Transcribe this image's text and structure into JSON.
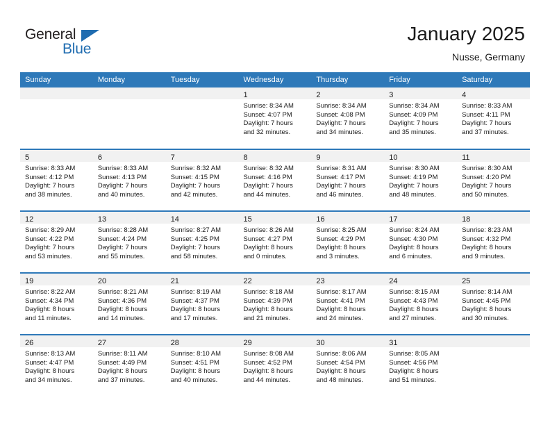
{
  "brand": {
    "name_part1": "General",
    "name_part2": "Blue",
    "triangle_color": "#1f6cb0",
    "text_color": "#231f20"
  },
  "header": {
    "month_title": "January 2025",
    "location": "Nusse, Germany"
  },
  "theme": {
    "header_bg": "#2e79b9",
    "header_text": "#ffffff",
    "daynum_band_bg": "#f1f1f1",
    "cell_bg": "#ffffff",
    "row_divider": "#2e79b9",
    "body_text": "#1a1a1a"
  },
  "weekday_headers": [
    "Sunday",
    "Monday",
    "Tuesday",
    "Wednesday",
    "Thursday",
    "Friday",
    "Saturday"
  ],
  "weeks": [
    [
      {
        "day": "",
        "empty": true,
        "sunrise": "",
        "sunset": "",
        "daylight1": "",
        "daylight2": ""
      },
      {
        "day": "",
        "empty": true,
        "sunrise": "",
        "sunset": "",
        "daylight1": "",
        "daylight2": ""
      },
      {
        "day": "",
        "empty": true,
        "sunrise": "",
        "sunset": "",
        "daylight1": "",
        "daylight2": ""
      },
      {
        "day": "1",
        "empty": false,
        "sunrise": "Sunrise: 8:34 AM",
        "sunset": "Sunset: 4:07 PM",
        "daylight1": "Daylight: 7 hours",
        "daylight2": "and 32 minutes."
      },
      {
        "day": "2",
        "empty": false,
        "sunrise": "Sunrise: 8:34 AM",
        "sunset": "Sunset: 4:08 PM",
        "daylight1": "Daylight: 7 hours",
        "daylight2": "and 34 minutes."
      },
      {
        "day": "3",
        "empty": false,
        "sunrise": "Sunrise: 8:34 AM",
        "sunset": "Sunset: 4:09 PM",
        "daylight1": "Daylight: 7 hours",
        "daylight2": "and 35 minutes."
      },
      {
        "day": "4",
        "empty": false,
        "sunrise": "Sunrise: 8:33 AM",
        "sunset": "Sunset: 4:11 PM",
        "daylight1": "Daylight: 7 hours",
        "daylight2": "and 37 minutes."
      }
    ],
    [
      {
        "day": "5",
        "empty": false,
        "sunrise": "Sunrise: 8:33 AM",
        "sunset": "Sunset: 4:12 PM",
        "daylight1": "Daylight: 7 hours",
        "daylight2": "and 38 minutes."
      },
      {
        "day": "6",
        "empty": false,
        "sunrise": "Sunrise: 8:33 AM",
        "sunset": "Sunset: 4:13 PM",
        "daylight1": "Daylight: 7 hours",
        "daylight2": "and 40 minutes."
      },
      {
        "day": "7",
        "empty": false,
        "sunrise": "Sunrise: 8:32 AM",
        "sunset": "Sunset: 4:15 PM",
        "daylight1": "Daylight: 7 hours",
        "daylight2": "and 42 minutes."
      },
      {
        "day": "8",
        "empty": false,
        "sunrise": "Sunrise: 8:32 AM",
        "sunset": "Sunset: 4:16 PM",
        "daylight1": "Daylight: 7 hours",
        "daylight2": "and 44 minutes."
      },
      {
        "day": "9",
        "empty": false,
        "sunrise": "Sunrise: 8:31 AM",
        "sunset": "Sunset: 4:17 PM",
        "daylight1": "Daylight: 7 hours",
        "daylight2": "and 46 minutes."
      },
      {
        "day": "10",
        "empty": false,
        "sunrise": "Sunrise: 8:30 AM",
        "sunset": "Sunset: 4:19 PM",
        "daylight1": "Daylight: 7 hours",
        "daylight2": "and 48 minutes."
      },
      {
        "day": "11",
        "empty": false,
        "sunrise": "Sunrise: 8:30 AM",
        "sunset": "Sunset: 4:20 PM",
        "daylight1": "Daylight: 7 hours",
        "daylight2": "and 50 minutes."
      }
    ],
    [
      {
        "day": "12",
        "empty": false,
        "sunrise": "Sunrise: 8:29 AM",
        "sunset": "Sunset: 4:22 PM",
        "daylight1": "Daylight: 7 hours",
        "daylight2": "and 53 minutes."
      },
      {
        "day": "13",
        "empty": false,
        "sunrise": "Sunrise: 8:28 AM",
        "sunset": "Sunset: 4:24 PM",
        "daylight1": "Daylight: 7 hours",
        "daylight2": "and 55 minutes."
      },
      {
        "day": "14",
        "empty": false,
        "sunrise": "Sunrise: 8:27 AM",
        "sunset": "Sunset: 4:25 PM",
        "daylight1": "Daylight: 7 hours",
        "daylight2": "and 58 minutes."
      },
      {
        "day": "15",
        "empty": false,
        "sunrise": "Sunrise: 8:26 AM",
        "sunset": "Sunset: 4:27 PM",
        "daylight1": "Daylight: 8 hours",
        "daylight2": "and 0 minutes."
      },
      {
        "day": "16",
        "empty": false,
        "sunrise": "Sunrise: 8:25 AM",
        "sunset": "Sunset: 4:29 PM",
        "daylight1": "Daylight: 8 hours",
        "daylight2": "and 3 minutes."
      },
      {
        "day": "17",
        "empty": false,
        "sunrise": "Sunrise: 8:24 AM",
        "sunset": "Sunset: 4:30 PM",
        "daylight1": "Daylight: 8 hours",
        "daylight2": "and 6 minutes."
      },
      {
        "day": "18",
        "empty": false,
        "sunrise": "Sunrise: 8:23 AM",
        "sunset": "Sunset: 4:32 PM",
        "daylight1": "Daylight: 8 hours",
        "daylight2": "and 9 minutes."
      }
    ],
    [
      {
        "day": "19",
        "empty": false,
        "sunrise": "Sunrise: 8:22 AM",
        "sunset": "Sunset: 4:34 PM",
        "daylight1": "Daylight: 8 hours",
        "daylight2": "and 11 minutes."
      },
      {
        "day": "20",
        "empty": false,
        "sunrise": "Sunrise: 8:21 AM",
        "sunset": "Sunset: 4:36 PM",
        "daylight1": "Daylight: 8 hours",
        "daylight2": "and 14 minutes."
      },
      {
        "day": "21",
        "empty": false,
        "sunrise": "Sunrise: 8:19 AM",
        "sunset": "Sunset: 4:37 PM",
        "daylight1": "Daylight: 8 hours",
        "daylight2": "and 17 minutes."
      },
      {
        "day": "22",
        "empty": false,
        "sunrise": "Sunrise: 8:18 AM",
        "sunset": "Sunset: 4:39 PM",
        "daylight1": "Daylight: 8 hours",
        "daylight2": "and 21 minutes."
      },
      {
        "day": "23",
        "empty": false,
        "sunrise": "Sunrise: 8:17 AM",
        "sunset": "Sunset: 4:41 PM",
        "daylight1": "Daylight: 8 hours",
        "daylight2": "and 24 minutes."
      },
      {
        "day": "24",
        "empty": false,
        "sunrise": "Sunrise: 8:15 AM",
        "sunset": "Sunset: 4:43 PM",
        "daylight1": "Daylight: 8 hours",
        "daylight2": "and 27 minutes."
      },
      {
        "day": "25",
        "empty": false,
        "sunrise": "Sunrise: 8:14 AM",
        "sunset": "Sunset: 4:45 PM",
        "daylight1": "Daylight: 8 hours",
        "daylight2": "and 30 minutes."
      }
    ],
    [
      {
        "day": "26",
        "empty": false,
        "sunrise": "Sunrise: 8:13 AM",
        "sunset": "Sunset: 4:47 PM",
        "daylight1": "Daylight: 8 hours",
        "daylight2": "and 34 minutes."
      },
      {
        "day": "27",
        "empty": false,
        "sunrise": "Sunrise: 8:11 AM",
        "sunset": "Sunset: 4:49 PM",
        "daylight1": "Daylight: 8 hours",
        "daylight2": "and 37 minutes."
      },
      {
        "day": "28",
        "empty": false,
        "sunrise": "Sunrise: 8:10 AM",
        "sunset": "Sunset: 4:51 PM",
        "daylight1": "Daylight: 8 hours",
        "daylight2": "and 40 minutes."
      },
      {
        "day": "29",
        "empty": false,
        "sunrise": "Sunrise: 8:08 AM",
        "sunset": "Sunset: 4:52 PM",
        "daylight1": "Daylight: 8 hours",
        "daylight2": "and 44 minutes."
      },
      {
        "day": "30",
        "empty": false,
        "sunrise": "Sunrise: 8:06 AM",
        "sunset": "Sunset: 4:54 PM",
        "daylight1": "Daylight: 8 hours",
        "daylight2": "and 48 minutes."
      },
      {
        "day": "31",
        "empty": false,
        "sunrise": "Sunrise: 8:05 AM",
        "sunset": "Sunset: 4:56 PM",
        "daylight1": "Daylight: 8 hours",
        "daylight2": "and 51 minutes."
      },
      {
        "day": "",
        "empty": true,
        "sunrise": "",
        "sunset": "",
        "daylight1": "",
        "daylight2": ""
      }
    ]
  ]
}
